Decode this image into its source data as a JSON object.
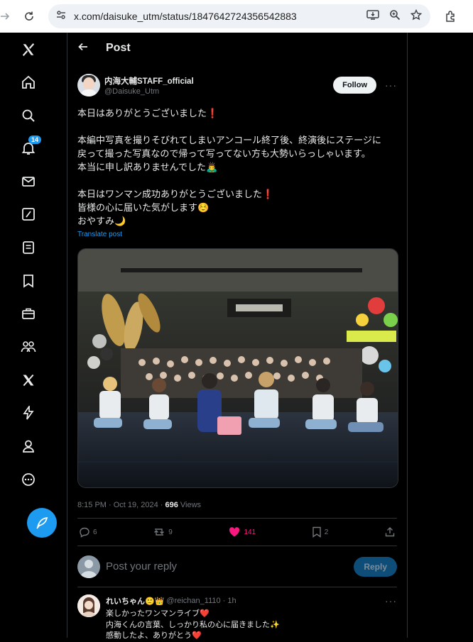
{
  "browser": {
    "url": "x.com/daisuke_utm/status/1847642724356542883"
  },
  "rail": {
    "notifications_badge": "14"
  },
  "header": {
    "title": "Post"
  },
  "tweet": {
    "display_name": "内海大輔STAFF_official",
    "handle": "@Daisuke_Utm",
    "follow_label": "Follow",
    "lines": [
      "本日はありがとうございました❗️",
      "",
      "本編中写真を撮りそびれてしまいアンコール終了後、終演後にステージに",
      "戻って撮った写真なので帰って写ってない方も大勢いらっしゃいます。",
      "本当に申し訳ありませんでした🙇‍♂️",
      "",
      "本日はワンマン成功ありがとうございました❗️",
      "皆様の心に届いた気がします☺️",
      "おやすみ🌙"
    ],
    "translate_label": "Translate post",
    "time": "8:15 PM · Oct 19, 2024 · ",
    "views_count": "696",
    "views_label": "Views",
    "replies": "6",
    "reposts": "9",
    "likes": "141",
    "bookmarks": "2"
  },
  "reply_box": {
    "placeholder": "Post your reply",
    "button": "Reply"
  },
  "comment": {
    "name": "れいちゃん🙂👑",
    "handle": "@reichan_1110 · 1h",
    "lines": [
      "楽しかったワンマンライブ❤️",
      "内海くんの言葉、しっかり私の心に届きました✨",
      "感動したよ、ありがとう❤️"
    ]
  },
  "colors": {
    "accent": "#1d9bf0",
    "like": "#f91880",
    "background": "#000000"
  }
}
